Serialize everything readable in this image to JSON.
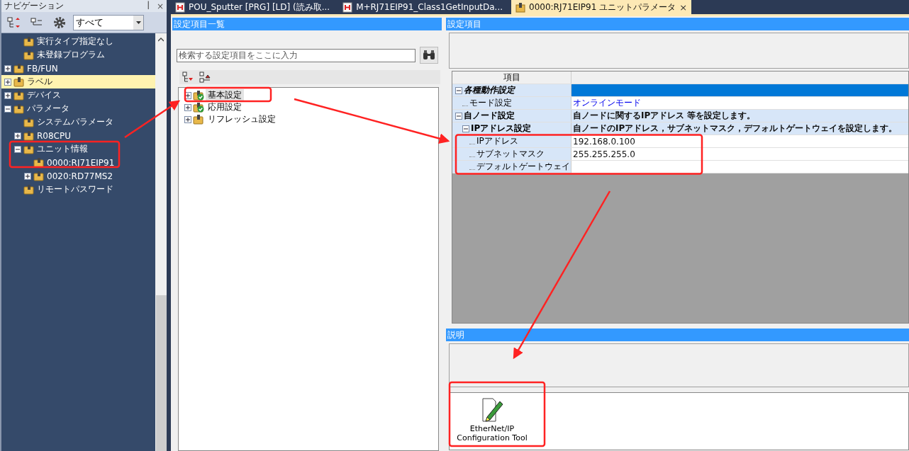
{
  "navigation": {
    "title": "ナビゲーション",
    "pin": "ꟾ",
    "close": "×",
    "filter": "すべて",
    "tree": [
      {
        "children": [
          {
            "label": "実行タイプ指定なし",
            "selected": false
          },
          {
            "label": "未登録プログラム",
            "selected": false
          }
        ]
      },
      {
        "label": "FB/FUN",
        "expanded": false,
        "selected": false
      },
      {
        "label": "ラベル",
        "expanded": false,
        "selected": true
      },
      {
        "label": "デバイス",
        "expanded": false,
        "selected": false
      },
      {
        "label": "パラメータ",
        "expanded": true,
        "selected": false,
        "children": [
          {
            "label": "システムパラメータ",
            "selected": false
          },
          {
            "label": "R08CPU",
            "expanded": false,
            "selected": false
          },
          {
            "label": "ユニット情報",
            "expanded": true,
            "selected": false,
            "children": [
              {
                "label": "0000:RJ71EIP91",
                "selected": false
              },
              {
                "label": "0020:RD77MS2",
                "expanded": false,
                "selected": false
              }
            ]
          },
          {
            "label": "リモートパスワード",
            "selected": false
          }
        ]
      }
    ]
  },
  "tabs": [
    {
      "label": "POU_Sputter [PRG] [LD] (読み取...",
      "selected": false
    },
    {
      "label": "M+RJ71EIP91_Class1GetInputDa...",
      "selected": false
    },
    {
      "label": "0000:RJ71EIP91 ユニットパラメータ",
      "selected": true,
      "close": "×"
    }
  ],
  "settings_list": {
    "title": "設定項目一覧",
    "search": {
      "placeholder": "検索する設定項目をここに入力"
    },
    "items": [
      {
        "label": "基本設定",
        "kind": "checked",
        "selected": true,
        "expanded": false
      },
      {
        "label": "応用設定",
        "kind": "checked",
        "selected": false,
        "expanded": false
      },
      {
        "label": "リフレッシュ設定",
        "kind": "plain",
        "selected": false,
        "expanded": false
      }
    ]
  },
  "settings": {
    "title": "設定項目",
    "column_header": "項目",
    "rows": [
      {
        "kind": "group",
        "label": "各種動作設定",
        "italic": true,
        "expanded": true,
        "selected": true,
        "children": [
          {
            "kind": "choice",
            "label": "モード設定",
            "value": "オンラインモード",
            "selected": false
          }
        ]
      },
      {
        "kind": "group",
        "label": "自ノード設定",
        "italic": false,
        "expanded": true,
        "selected": false,
        "value": "自ノードに関するIPアドレス 等を設定します。",
        "children": [
          {
            "kind": "group",
            "label": "IPアドレス設定",
            "italic": false,
            "expanded": true,
            "selected": false,
            "value": "自ノードのIPアドレス，サブネットマスク，デフォルトゲートウェイを設定します。",
            "children": [
              {
                "kind": "text",
                "label": "IPアドレス",
                "value": "192.168.0.100",
                "selected": false
              },
              {
                "kind": "text",
                "label": "サブネットマスク",
                "value": "255.255.255.0",
                "selected": false
              },
              {
                "kind": "text",
                "label": "デフォルトゲートウェイ",
                "selected": false
              }
            ]
          }
        ]
      }
    ]
  },
  "description": {
    "title": "説明",
    "tools": [
      {
        "label": "EtherNet/IP Configuration Tool"
      }
    ]
  }
}
